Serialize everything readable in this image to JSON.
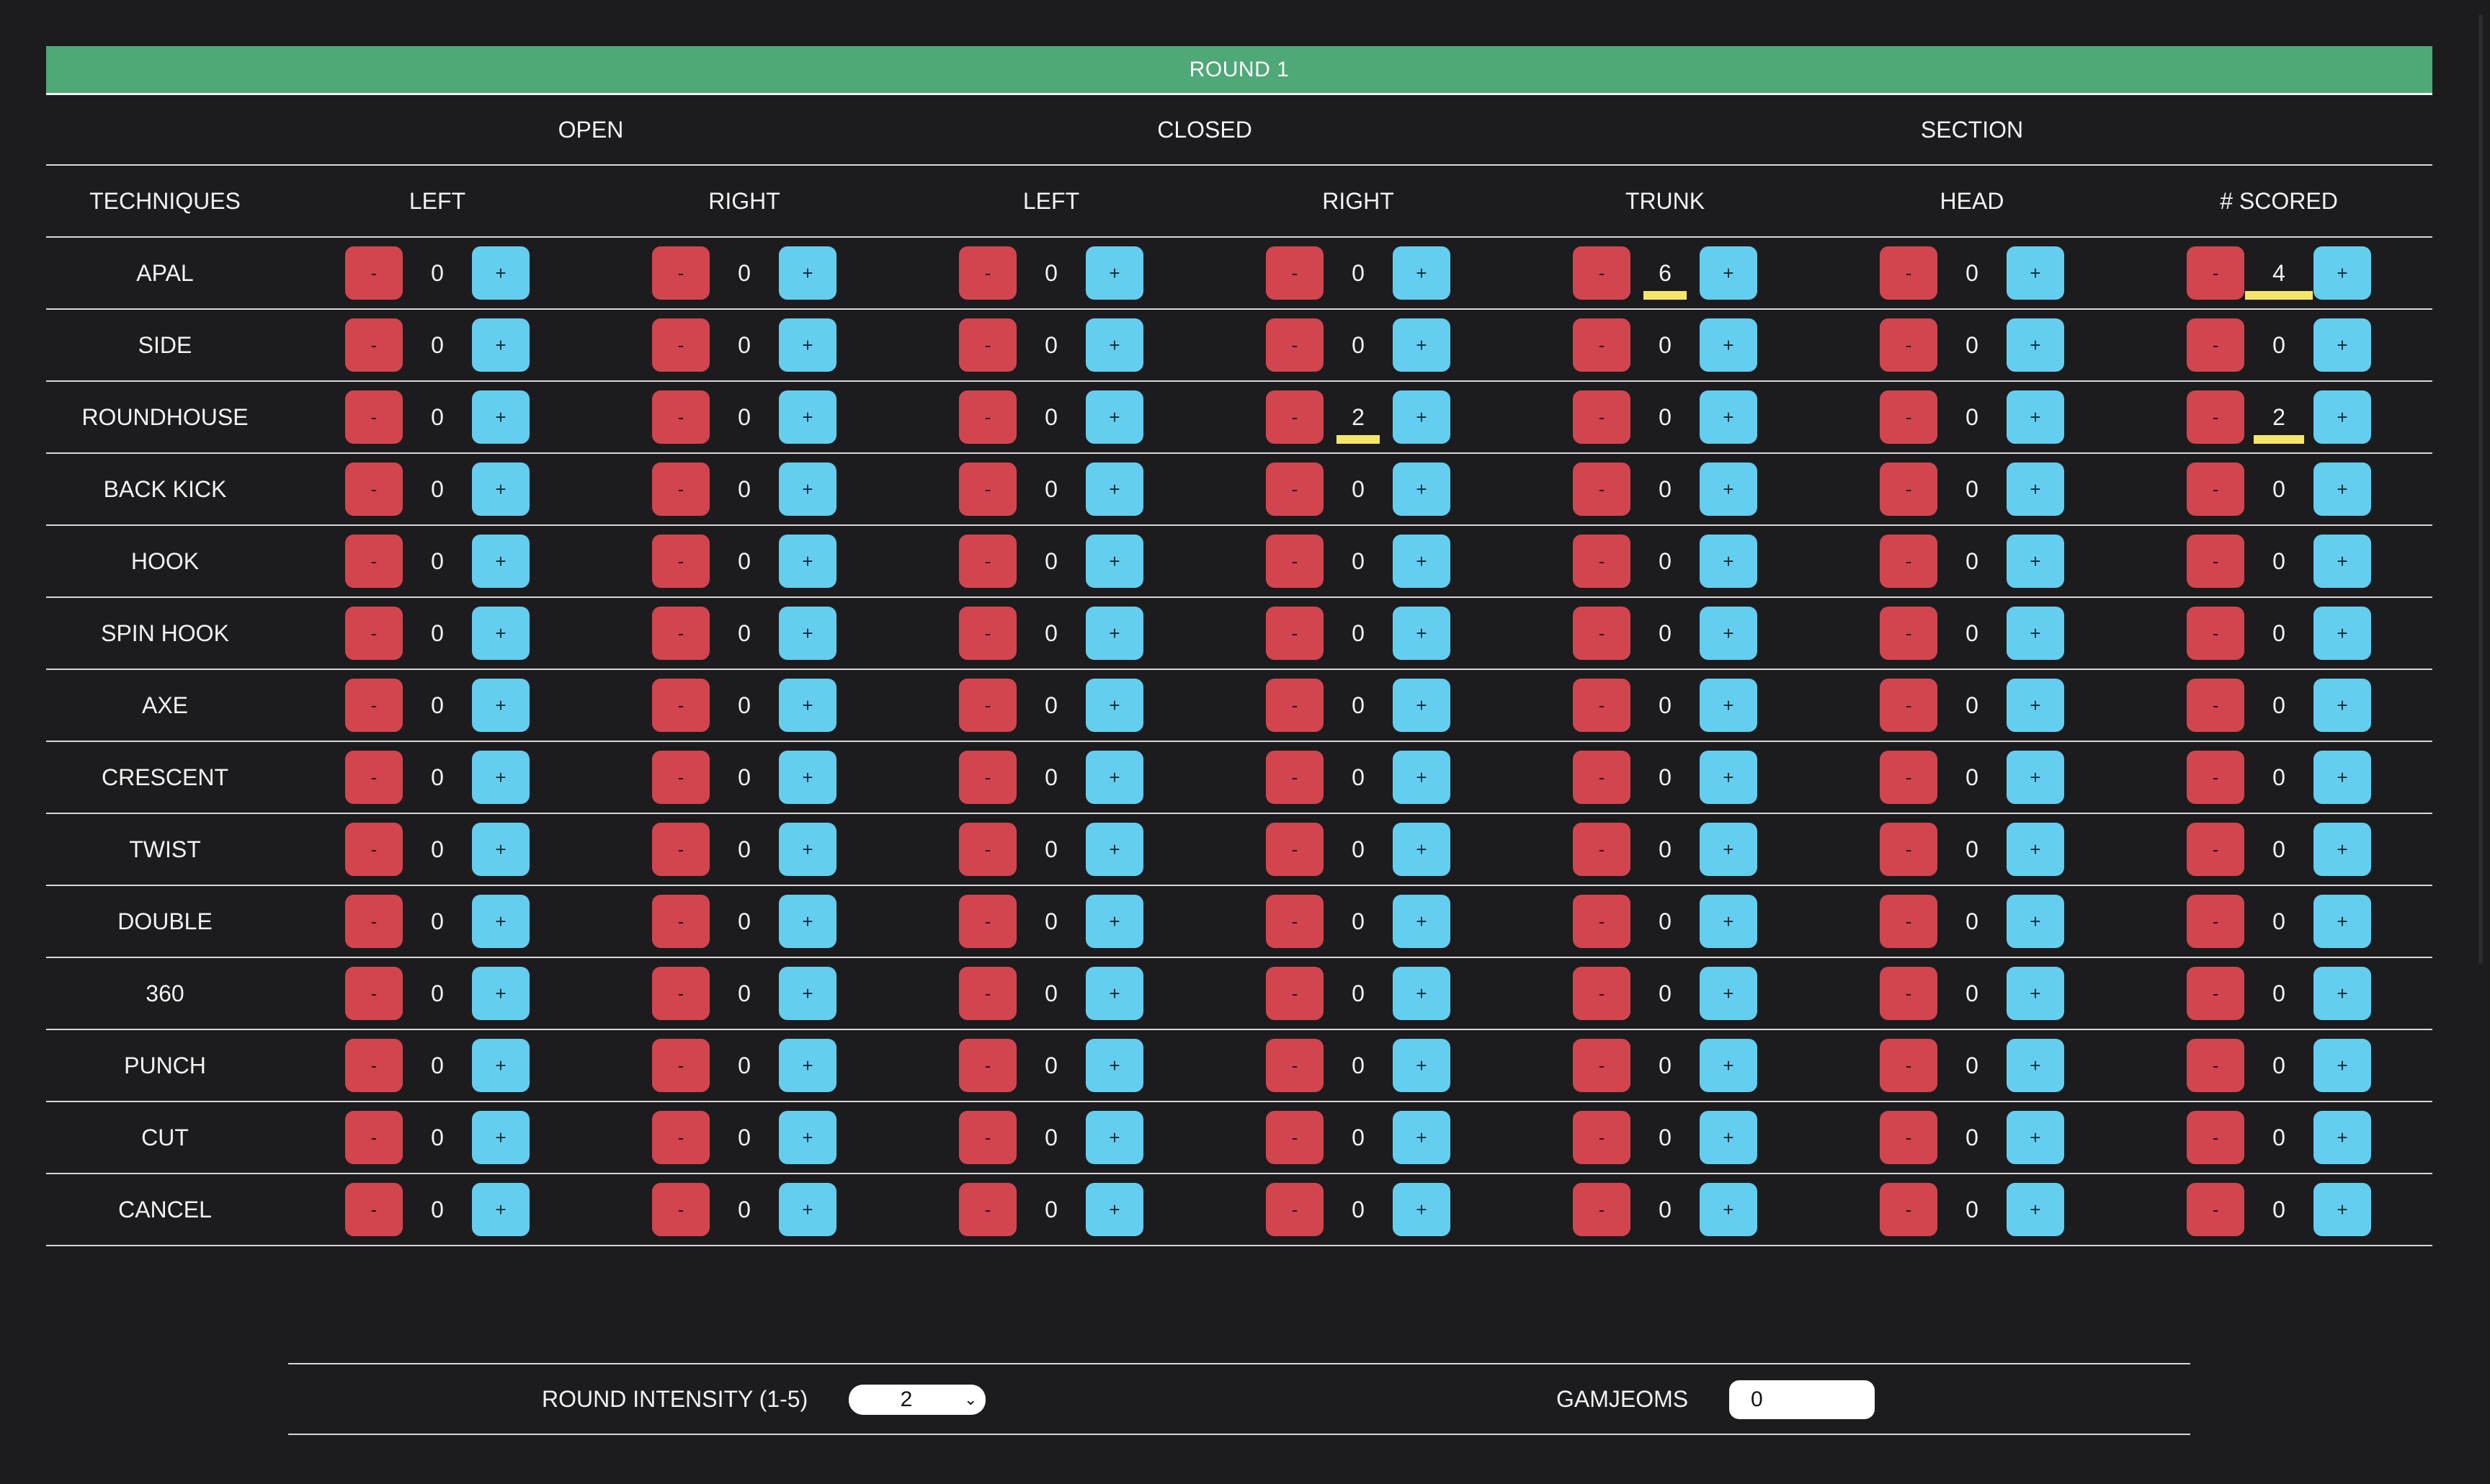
{
  "round_title": "ROUND 1",
  "groups": {
    "open": "OPEN",
    "closed": "CLOSED",
    "section": "SECTION"
  },
  "columns": [
    "TECHNIQUES",
    "LEFT",
    "RIGHT",
    "LEFT",
    "RIGHT",
    "TRUNK",
    "HEAD",
    "# SCORED"
  ],
  "buttons": {
    "minus": "-",
    "plus": "+"
  },
  "rows": [
    {
      "technique": "APAL",
      "values": [
        "0",
        "0",
        "0",
        "0",
        "6",
        "0",
        "4"
      ]
    },
    {
      "technique": "SIDE",
      "values": [
        "0",
        "0",
        "0",
        "0",
        "0",
        "0",
        "0"
      ]
    },
    {
      "technique": "ROUNDHOUSE",
      "values": [
        "0",
        "0",
        "0",
        "2",
        "0",
        "0",
        "2"
      ]
    },
    {
      "technique": "BACK KICK",
      "values": [
        "0",
        "0",
        "0",
        "0",
        "0",
        "0",
        "0"
      ]
    },
    {
      "technique": "HOOK",
      "values": [
        "0",
        "0",
        "0",
        "0",
        "0",
        "0",
        "0"
      ]
    },
    {
      "technique": "SPIN HOOK",
      "values": [
        "0",
        "0",
        "0",
        "0",
        "0",
        "0",
        "0"
      ]
    },
    {
      "technique": "AXE",
      "values": [
        "0",
        "0",
        "0",
        "0",
        "0",
        "0",
        "0"
      ]
    },
    {
      "technique": "CRESCENT",
      "values": [
        "0",
        "0",
        "0",
        "0",
        "0",
        "0",
        "0"
      ]
    },
    {
      "technique": "TWIST",
      "values": [
        "0",
        "0",
        "0",
        "0",
        "0",
        "0",
        "0"
      ]
    },
    {
      "technique": "DOUBLE",
      "values": [
        "0",
        "0",
        "0",
        "0",
        "0",
        "0",
        "0"
      ]
    },
    {
      "technique": "360",
      "values": [
        "0",
        "0",
        "0",
        "0",
        "0",
        "0",
        "0"
      ]
    },
    {
      "technique": "PUNCH",
      "values": [
        "0",
        "0",
        "0",
        "0",
        "0",
        "0",
        "0"
      ]
    },
    {
      "technique": "CUT",
      "values": [
        "0",
        "0",
        "0",
        "0",
        "0",
        "0",
        "0"
      ]
    },
    {
      "technique": "CANCEL",
      "values": [
        "0",
        "0",
        "0",
        "0",
        "0",
        "0",
        "0"
      ]
    }
  ],
  "highlight_color": "#f5e66a",
  "colors": {
    "banner": "#4fa877",
    "minus_button": "#d2454f",
    "plus_button": "#64cef0",
    "background": "#1c1c1f"
  },
  "footer": {
    "intensity_label": "ROUND INTENSITY (1-5)",
    "intensity_value": "2",
    "gamjeoms_label": "GAMJEOMS",
    "gamjeoms_value": "0"
  }
}
